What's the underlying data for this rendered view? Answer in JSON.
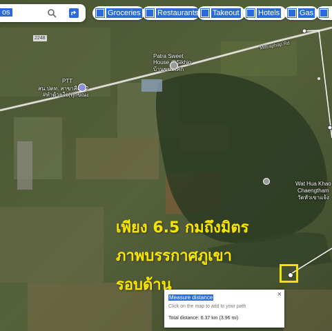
{
  "search": {
    "query": "os"
  },
  "chips": [
    {
      "label": "Groceries",
      "icon": "cart-icon"
    },
    {
      "label": "Restaurants",
      "icon": "fork-knife-icon"
    },
    {
      "label": "Takeout",
      "icon": "takeout-icon"
    },
    {
      "label": "Hotels",
      "icon": "bed-icon"
    },
    {
      "label": "Gas",
      "icon": "gas-icon"
    }
  ],
  "map_labels": {
    "road_number": "2248",
    "road_name": "Mittraphap Rd",
    "patra": "Patra Sweet\nHouse @Sikhio",
    "patra_thai": "บ้านขนมเค้ก",
    "ptt": "PTT",
    "ptt_thai": "สน.ปตท. สาขาสีคิ้ว 2",
    "ptt_thai2": "#ทำด้วยใจ(ทุกขณะ",
    "wat": "Wat Hua Khao",
    "wat2": "Chaengtham",
    "wat3": "วัดหัวเขาแจ้ง"
  },
  "overlay_text": {
    "line1": "เพียง 6.5 กมถึงมิตร",
    "line2": "ภาพบรรกาศภูเขา",
    "line3": "รอบด้าน"
  },
  "measure": {
    "title": "Measure distance",
    "hint": "Click on the map to add to your path",
    "total": "Total distance: 6.37 km (3.96 mi)",
    "close": "×"
  },
  "colors": {
    "accent": "#2a6bd8",
    "overlay": "#f6e600",
    "marker": "#f2e400"
  }
}
